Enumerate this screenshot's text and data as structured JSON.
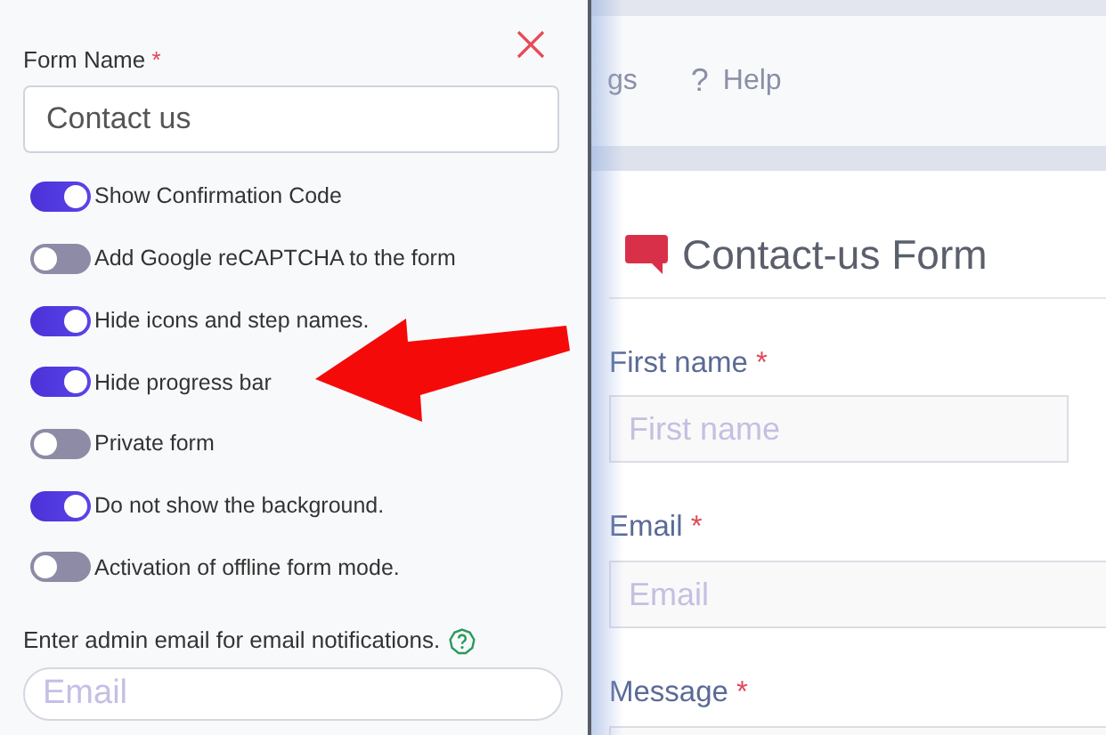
{
  "settings_panel": {
    "form_name_label": "Form Name",
    "form_name_required": "*",
    "form_name_value": "Contact us",
    "toggles": [
      {
        "label": "Show Confirmation Code",
        "on": true
      },
      {
        "label": "Add Google reCAPTCHA to the form",
        "on": false
      },
      {
        "label": "Hide icons and step names.",
        "on": true
      },
      {
        "label": "Hide progress bar",
        "on": true
      },
      {
        "label": "Private form",
        "on": false
      },
      {
        "label": "Do not show the background.",
        "on": true
      },
      {
        "label": "Activation of offline form mode.",
        "on": false
      }
    ],
    "admin_email_label": "Enter admin email for email notifications.",
    "admin_email_placeholder": "Email"
  },
  "nav": {
    "items": [
      {
        "label": "gs"
      },
      {
        "icon_text": "?",
        "label": "Help"
      }
    ]
  },
  "form": {
    "title": "Contact-us Form",
    "fields": [
      {
        "label": "First name",
        "required": "*",
        "placeholder": "First name",
        "kind": "short"
      },
      {
        "label": "Email",
        "required": "*",
        "placeholder": "Email",
        "kind": "wide"
      },
      {
        "label": "Message",
        "required": "*",
        "kind": "wide"
      }
    ]
  }
}
